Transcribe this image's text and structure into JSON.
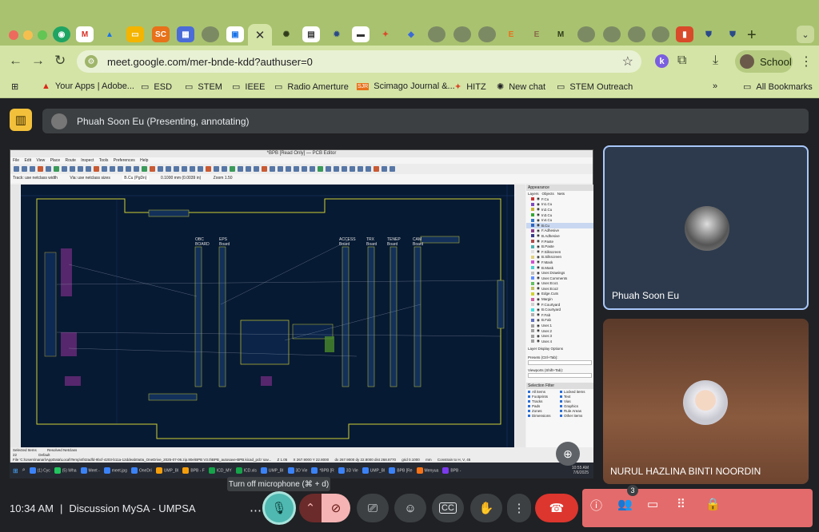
{
  "browser": {
    "url": "meet.google.com/mer-bnde-kdd?authuser=0",
    "profile_label": "School",
    "bookmarks": [
      {
        "label": "Your Apps | Adobe..."
      },
      {
        "label": "ESD"
      },
      {
        "label": "STEM"
      },
      {
        "label": "IEEE"
      },
      {
        "label": "Radio Amerture"
      },
      {
        "label": "Scimago Journal &..."
      },
      {
        "label": "HITZ"
      },
      {
        "label": "New chat"
      },
      {
        "label": "STEM Outreach"
      }
    ],
    "all_bookmarks_label": "All Bookmarks",
    "tab_badges": {
      "sc": "SC",
      "e1": "E",
      "e2": "E",
      "m": "M"
    }
  },
  "meet": {
    "presenter_label": "Phuah Soon Eu (Presenting, annotating)",
    "participants": [
      {
        "name": "Phuah Soon Eu"
      },
      {
        "name": "NURUL HAZLINA BINTI NOORDIN"
      }
    ],
    "tooltip": "Turn off microphone (⌘ + d)",
    "time": "10:34 AM",
    "meeting_name": "Discussion MySA - UMPSA",
    "people_count": "3"
  },
  "kicad": {
    "title": "*BPB [Read Only] — PCB Editor",
    "menu": [
      "File",
      "Edit",
      "View",
      "Place",
      "Route",
      "Inspect",
      "Tools",
      "Preferences",
      "Help"
    ],
    "track_option": "Track: use netclass width",
    "via_option": "Via: use netclass sizes",
    "layer_select": "B.Cu (PgDn)",
    "grid_option": "0.1000 mm (0.0039 in)",
    "zoom_option": "Zoom 1.50",
    "panel_title": "Appearance",
    "panel_tabs": [
      "Layers",
      "Objects",
      "Nets"
    ],
    "layers": [
      {
        "name": "F.Cu",
        "color": "#c83434"
      },
      {
        "name": "In1.Cu",
        "color": "#7f4abf"
      },
      {
        "name": "In2.Cu",
        "color": "#c8b434"
      },
      {
        "name": "In3.Cu",
        "color": "#34a834"
      },
      {
        "name": "In4.Cu",
        "color": "#3478c8"
      },
      {
        "name": "B.Cu",
        "color": "#2e64c0"
      },
      {
        "name": "F.Adhesive",
        "color": "#8a3a8a"
      },
      {
        "name": "B.Adhesive",
        "color": "#3a3a8a"
      },
      {
        "name": "F.Paste",
        "color": "#b04a4a"
      },
      {
        "name": "B.Paste",
        "color": "#4ab0b0"
      },
      {
        "name": "F.Silkscreen",
        "color": "#e0e0e0"
      },
      {
        "name": "B.Silkscreen",
        "color": "#e0d080"
      },
      {
        "name": "F.Mask",
        "color": "#d050d0"
      },
      {
        "name": "B.Mask",
        "color": "#50d0d0"
      },
      {
        "name": "User.Drawings",
        "color": "#c0c0c0"
      },
      {
        "name": "User.Comments",
        "color": "#6090ff"
      },
      {
        "name": "User.Eco1",
        "color": "#60c060"
      },
      {
        "name": "User.Eco2",
        "color": "#c0c060"
      },
      {
        "name": "Edge.Cuts",
        "color": "#d0d034"
      },
      {
        "name": "Margin",
        "color": "#d060a0"
      },
      {
        "name": "F.Courtyard",
        "color": "#d0d0d0"
      },
      {
        "name": "B.Courtyard",
        "color": "#40e0e0"
      },
      {
        "name": "F.Fab",
        "color": "#b0b0b0"
      },
      {
        "name": "B.Fab",
        "color": "#6070c0"
      },
      {
        "name": "User.1",
        "color": "#a0a0a0"
      },
      {
        "name": "User.2",
        "color": "#a0a0a0"
      },
      {
        "name": "User.3",
        "color": "#a0a0a0"
      },
      {
        "name": "User.4",
        "color": "#a0a0a0"
      }
    ],
    "layer_display_options": "Layer Display Options",
    "presets_label": "Presets (Ctrl+Tab):",
    "viewports_label": "Viewports (Shift+Tab):",
    "selection_filter_label": "Selection Filter",
    "selection_filter": [
      "All items",
      "Locked items",
      "Footprints",
      "Text",
      "Tracks",
      "Vias",
      "Pads",
      "Graphics",
      "Zones",
      "Rule Areas",
      "Dimensions",
      "Other items"
    ],
    "board_labels": [
      "OBC",
      "EPS",
      "ACCESS",
      "TRX",
      "TENEP",
      "CAM",
      "BOARD",
      "Board",
      "Board",
      "Board",
      "Board",
      "Board"
    ],
    "status_selected": "Selected Items",
    "status_selected_value": "22",
    "status_resolved": "Resolved Netclass",
    "status_resolved_value": "Default",
    "status_path": "File 'C:\\Users\\nanari\\AppData\\Local\\Temp\\4f42adfd-9bcf-4203-b11a-12ddeab0a0a_OneDrive_2025-07-06.zip.80e\\BPB V3.0\\BPB_autosave-BPB.kicad_pcb' sav...",
    "status_z": "Z 1.05",
    "status_xy": "X 267.9000  Y 22.8000",
    "status_d": "dx 267.9000  dy 22.8000  dist 268.8770",
    "status_grid": "grid 0.1000",
    "status_unit": "mm",
    "status_constrain": "Constrain to H, V, 45"
  },
  "taskbar": [
    {
      "label": "(1) Cyc",
      "color": "#3b82f6"
    },
    {
      "label": "(5) Wha",
      "color": "#22c55e"
    },
    {
      "label": "Meet -",
      "color": "#3b82f6"
    },
    {
      "label": "meet.jpg",
      "color": "#3b82f6"
    },
    {
      "label": "OneDri",
      "color": "#3b82f6"
    },
    {
      "label": "UMP_BI",
      "color": "#f59e0b"
    },
    {
      "label": "BPB - F",
      "color": "#f59e0b"
    },
    {
      "label": "ICD_MY",
      "color": "#16a34a"
    },
    {
      "label": "ICD.xls",
      "color": "#16a34a"
    },
    {
      "label": "UMP_BI",
      "color": "#3b82f6"
    },
    {
      "label": "3D Vie",
      "color": "#3b82f6"
    },
    {
      "label": "*BPB [R",
      "color": "#3b82f6"
    },
    {
      "label": "3D Vie",
      "color": "#3b82f6"
    },
    {
      "label": "UMP_BI",
      "color": "#3b82f6"
    },
    {
      "label": "BPB [Re",
      "color": "#3b82f6"
    },
    {
      "label": "Menyua",
      "color": "#f97316"
    },
    {
      "label": "BPB -",
      "color": "#7c3aed"
    }
  ],
  "taskbar_time": "10:55 AM",
  "taskbar_date": "7/6/2025"
}
